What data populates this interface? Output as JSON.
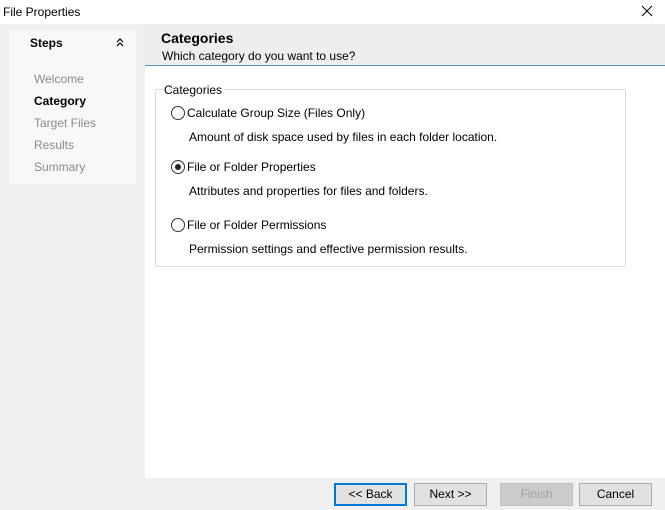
{
  "window": {
    "title": "File Properties"
  },
  "steps": {
    "header": "Steps",
    "items": [
      {
        "label": "Welcome",
        "current": false
      },
      {
        "label": "Category",
        "current": true
      },
      {
        "label": "Target Files",
        "current": false
      },
      {
        "label": "Results",
        "current": false
      },
      {
        "label": "Summary",
        "current": false
      }
    ]
  },
  "header": {
    "title": "Categories",
    "subtitle": "Which category do you want to use?",
    "accent_color": "#5a95c6"
  },
  "categories": {
    "legend": "Categories",
    "options": [
      {
        "label": "Calculate Group Size (Files Only)",
        "description": "Amount of disk space used by files in each folder location.",
        "selected": false
      },
      {
        "label": "File or Folder Properties",
        "description": "Attributes and properties for files and folders.",
        "selected": true
      },
      {
        "label": "File or Folder Permissions",
        "description": "Permission settings and effective permission results.",
        "selected": false
      }
    ]
  },
  "buttons": {
    "back": "<< Back",
    "next": "Next >>",
    "finish": "Finish",
    "cancel": "Cancel"
  },
  "icons": {
    "close": "close-icon",
    "collapse": "chevron-double-up-icon"
  }
}
